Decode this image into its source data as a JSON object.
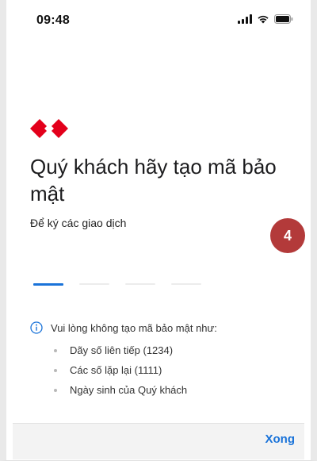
{
  "status_bar": {
    "time": "09:48",
    "icons": [
      "signal-icon",
      "wifi-icon",
      "battery-icon"
    ]
  },
  "brand": {
    "logo_icon": "diamond-logo-icon",
    "logo_color": "#e3001b"
  },
  "main": {
    "title": "Quý khách hãy tạo mã bảo mật",
    "subtitle": "Để ký các giao dịch",
    "step_badge": "4",
    "step_badge_color": "#b33a3a"
  },
  "pin_indicator": {
    "total": 4,
    "active_index": 0,
    "active_color": "#1a73d9"
  },
  "notice": {
    "icon": "info-icon",
    "text": "Vui lòng không tạo mã bảo mật như:",
    "rules": [
      "Dãy số liên tiếp (1234)",
      "Các số lặp lại (1111)",
      "Ngày sinh của Quý khách"
    ]
  },
  "bottom_bar": {
    "done_label": "Xong",
    "accent_color": "#1a73d9"
  }
}
